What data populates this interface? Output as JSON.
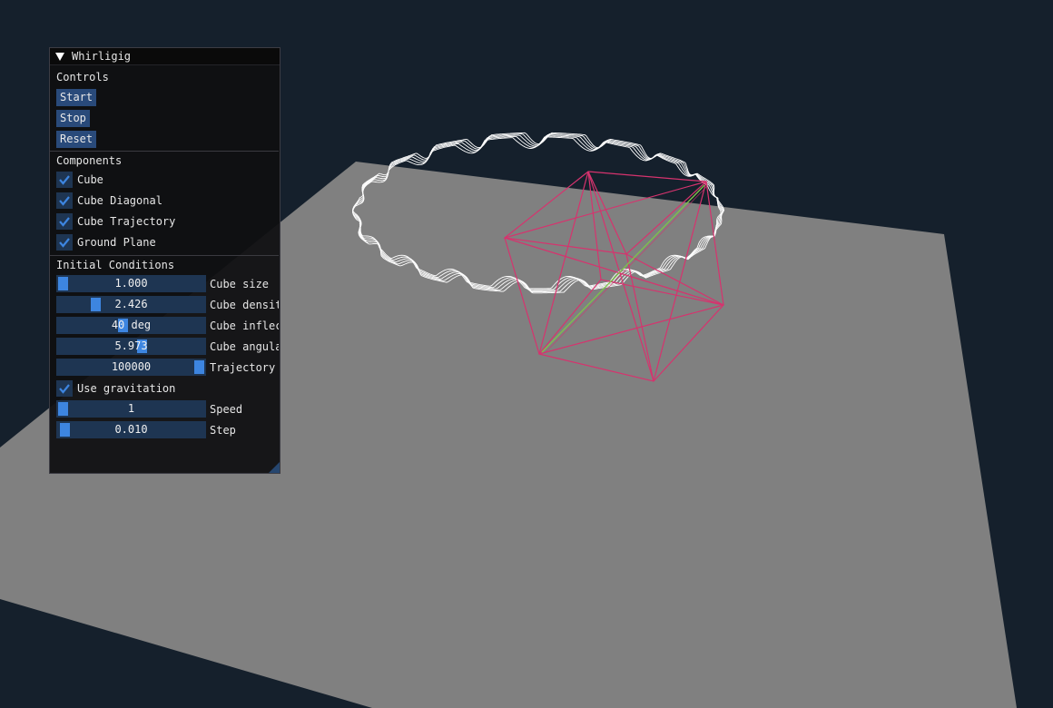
{
  "window": {
    "title": "Whirligig"
  },
  "controls": {
    "header": "Controls",
    "start_label": "Start",
    "stop_label": "Stop",
    "reset_label": "Reset"
  },
  "components": {
    "header": "Components",
    "items": [
      {
        "label": "Cube",
        "checked": true
      },
      {
        "label": "Cube Diagonal",
        "checked": true
      },
      {
        "label": "Cube Trajectory",
        "checked": true
      },
      {
        "label": "Ground Plane",
        "checked": true
      }
    ]
  },
  "initial_conditions": {
    "header": "Initial Conditions",
    "sliders": [
      {
        "display": "1.000",
        "label": "Cube size",
        "fraction": 0.0
      },
      {
        "display": "2.426",
        "label": "Cube densit",
        "fraction": 0.24
      },
      {
        "display": "40 deg",
        "label": "Cube inflec",
        "fraction": 0.44
      },
      {
        "display": "5.973",
        "label": "Cube angula",
        "fraction": 0.58
      },
      {
        "display": "100000",
        "label": "Trajectory",
        "fraction": 1.0
      }
    ],
    "gravitation": {
      "label": "Use gravitation",
      "checked": true
    },
    "sliders2": [
      {
        "display": "1",
        "label": "Speed",
        "fraction": 0.0
      },
      {
        "display": "0.010",
        "label": "Step",
        "fraction": 0.01
      }
    ]
  },
  "colors": {
    "background": "#15202c",
    "ground": "#808080",
    "cube": "#d6336e",
    "diagonal": "#7fc24a",
    "trajectory": "#ffffff",
    "accent": "#3d85e0"
  }
}
